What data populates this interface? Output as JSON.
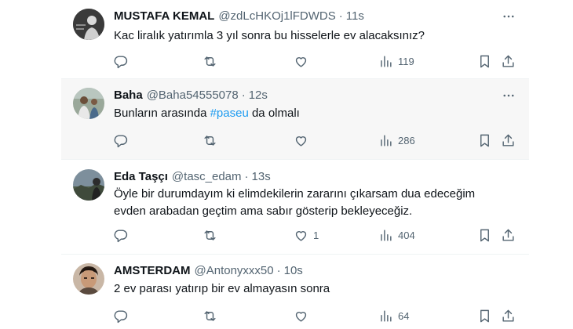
{
  "tweets": [
    {
      "name": "MUSTAFA KEMAL",
      "handle": "@zdLcHKOj1lFDWDS",
      "sep": "·",
      "time": "11s",
      "text": "Kac liralık yatırımla 3 yıl sonra  bu hisselerle ev alacaksınız?",
      "text_pre": "",
      "hashtag": "",
      "text_post": "",
      "likes": "",
      "views": "119"
    },
    {
      "name": "Baha",
      "handle": "@Baha54555078",
      "sep": "·",
      "time": "12s",
      "text_pre": "Bunların arasında ",
      "hashtag": "#paseu",
      "text_post": " da olmalı",
      "likes": "",
      "views": "286"
    },
    {
      "name": "Eda Taşçı",
      "handle": "@tasc_edam",
      "sep": "·",
      "time": "13s",
      "text_line1": "Öyle bir durumdayım ki elimdekilerin zararını çıkarsam dua edeceğim",
      "text_line2": "evden arabadan geçtim ama sabır gösterip bekleyeceğiz.",
      "likes": "1",
      "views": "404"
    },
    {
      "name": "AMSTERDAM",
      "handle": "@Antonyxxx50",
      "sep": "·",
      "time": "10s",
      "text": "2 ev parası yatırıp bir ev almayasın sonra",
      "likes": "",
      "views": "64"
    }
  ],
  "icons": {
    "reply": "reply-icon",
    "retweet": "retweet-icon",
    "like": "like-icon",
    "views": "views-icon",
    "bookmark": "bookmark-icon",
    "share": "share-icon",
    "more": "more-icon"
  },
  "colors": {
    "text": "#0f1419",
    "secondary": "#536471",
    "hashtag": "#1d9bf0",
    "divider": "#eff3f4",
    "highlight": "#f7f7f7"
  }
}
